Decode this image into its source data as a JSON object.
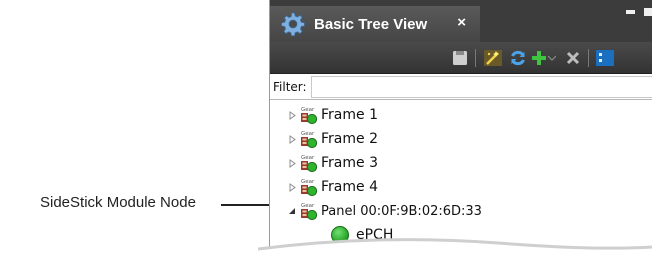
{
  "callout": {
    "label": "SideStick Module Node"
  },
  "window": {
    "tab_title": "Basic Tree View",
    "close_glyph": "×"
  },
  "toolbar": {
    "buttons": [
      "save-icon",
      "wand-icon",
      "refresh-icon",
      "add-icon",
      "delete-icon",
      "layout-icon"
    ]
  },
  "filter": {
    "label": "Filter:",
    "value": "",
    "placeholder": ""
  },
  "tree": {
    "nodes": [
      {
        "label": "Frame 1",
        "expanded": false,
        "icon_text": "Gear"
      },
      {
        "label": "Frame 2",
        "expanded": false,
        "icon_text": "Gear"
      },
      {
        "label": "Frame 3",
        "expanded": false,
        "icon_text": "Gear"
      },
      {
        "label": "Frame 4",
        "expanded": false,
        "icon_text": "Gear"
      },
      {
        "label": "Panel 00:0F:9B:02:6D:33",
        "expanded": true,
        "icon_text": "Gear",
        "children": [
          {
            "label": "ePCH",
            "status_color": "#2db32d"
          }
        ]
      }
    ]
  },
  "colors": {
    "titlebar": "#3c3c3c",
    "status_green": "#2db32d",
    "add_green": "#3fc43f",
    "refresh_blue": "#4aa3e8"
  }
}
